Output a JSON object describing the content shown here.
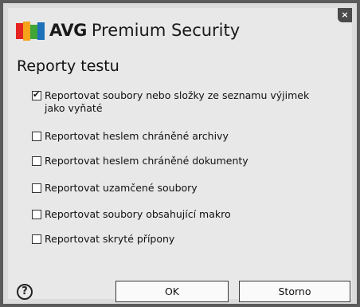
{
  "window": {
    "brand": "AVG",
    "product": "Premium Security",
    "close_label": "×"
  },
  "dialog": {
    "heading": "Reporty testu",
    "options": [
      {
        "label": "Reportovat soubory nebo složky ze seznamu výjimek jako vyňaté",
        "checked": true
      },
      {
        "label": "Reportovat heslem chráněné archivy",
        "checked": false
      },
      {
        "label": "Reportovat heslem chráněné dokumenty",
        "checked": false
      },
      {
        "label": "Reportovat uzamčené soubory",
        "checked": false
      },
      {
        "label": "Reportovat soubory obsahující makro",
        "checked": false
      },
      {
        "label": "Reportovat skryté přípony",
        "checked": false
      }
    ]
  },
  "footer": {
    "help_label": "?",
    "ok_label": "OK",
    "cancel_label": "Storno"
  }
}
